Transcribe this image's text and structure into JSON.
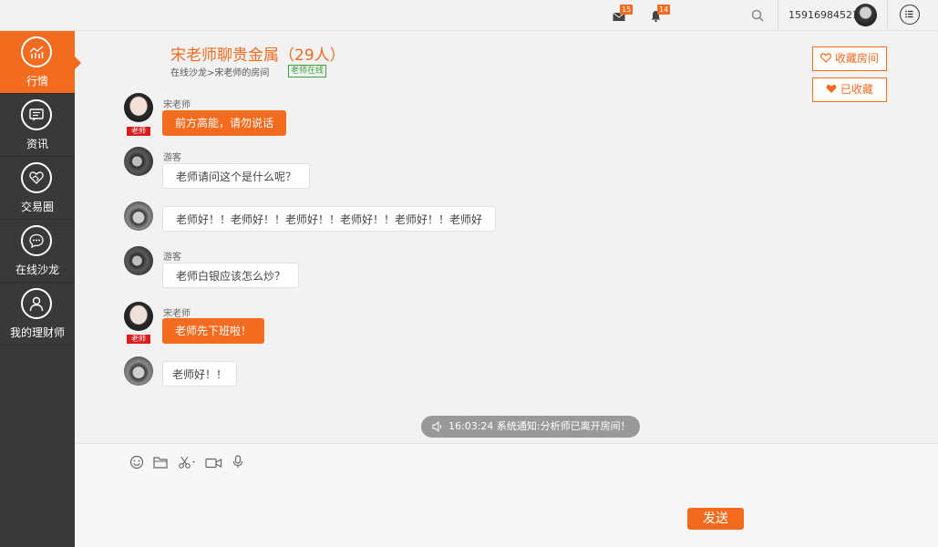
{
  "topbar": {
    "mail_badge": "15",
    "bell_badge": "14",
    "phone": "15916984521"
  },
  "sidebar": {
    "items": [
      {
        "label": "行情",
        "icon": "chart-icon",
        "active": true
      },
      {
        "label": "资讯",
        "icon": "news-icon",
        "active": false
      },
      {
        "label": "交易圈",
        "icon": "handshake-icon",
        "active": false
      },
      {
        "label": "在线沙龙",
        "icon": "chat-icon",
        "active": false
      },
      {
        "label": "我的理财师",
        "icon": "person-icon",
        "active": false
      }
    ]
  },
  "header": {
    "title": "宋老师聊贵金属（29人）",
    "breadcrumb": "在线沙龙>宋老师的房间",
    "online_tag": "老师在线",
    "favorite_label": "收藏房间",
    "favorited_label": "已收藏"
  },
  "messages": [
    {
      "sender": "宋老师",
      "role": "老师",
      "text": "前方高能，请勿说话",
      "style": "orange"
    },
    {
      "sender": "游客",
      "text": "老师请问这个是什么呢？",
      "style": "white"
    },
    {
      "sender": "",
      "text": "老师好！！老师好！！老师好！！老师好！！老师好！！老师好",
      "style": "white"
    },
    {
      "sender": "游客",
      "text": "老师白银应该怎么炒？",
      "style": "white"
    },
    {
      "sender": "宋老师",
      "role": "老师",
      "text": "老师先下班啦！",
      "style": "orange"
    },
    {
      "sender": "",
      "text": "老师好！！",
      "style": "white"
    }
  ],
  "notice": {
    "text": "16:03:24 系统通知:分析师已离开房间！"
  },
  "input": {
    "tools": [
      "emoji-icon",
      "folder-icon",
      "scissors-icon",
      "video-icon",
      "microphone-icon"
    ],
    "send_label": "发送"
  },
  "colors": {
    "accent": "#f26b1f",
    "sidebar": "#393939"
  }
}
